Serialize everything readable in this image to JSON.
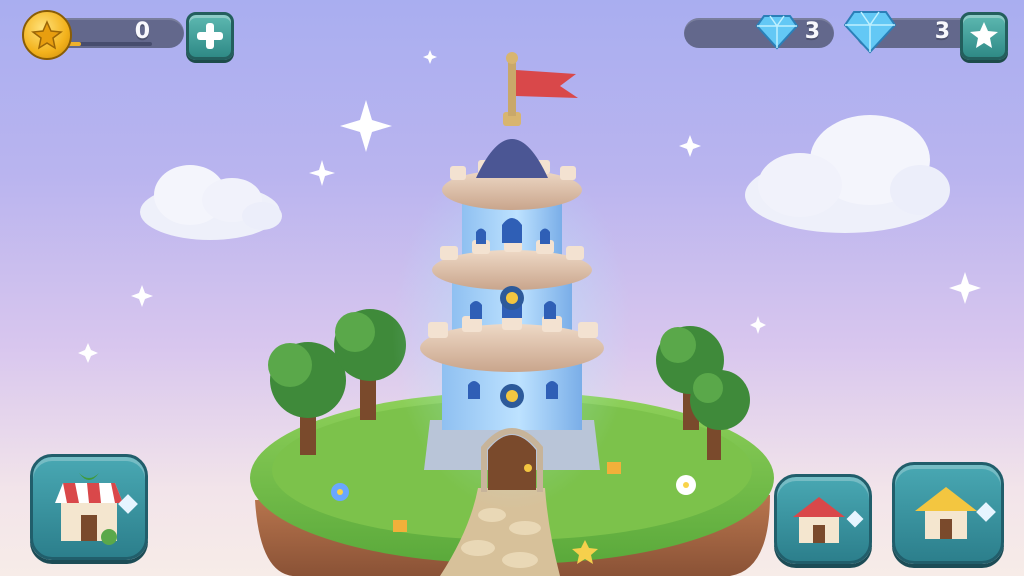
{
  "hud": {
    "coins": {
      "value": "0",
      "icon": "gold-star-coin-icon",
      "progress": 0.18
    },
    "add_button": {
      "icon": "plus-icon"
    },
    "gems_small": {
      "value": "3",
      "icon": "diamond-icon"
    },
    "gems_large": {
      "value": "3",
      "icon": "diamond-icon"
    },
    "star_button": {
      "icon": "star-icon"
    }
  },
  "bottom": {
    "shop_button": {
      "icon": "market-stall-icon"
    },
    "house_button": {
      "icon": "red-roof-house-icon"
    },
    "hut_button": {
      "icon": "yellow-roof-hut-icon"
    }
  },
  "colors": {
    "accent_teal": "#3a97a3",
    "gold": "#f3b21c",
    "gem": "#63c8f5",
    "flag": "#d9484a"
  }
}
